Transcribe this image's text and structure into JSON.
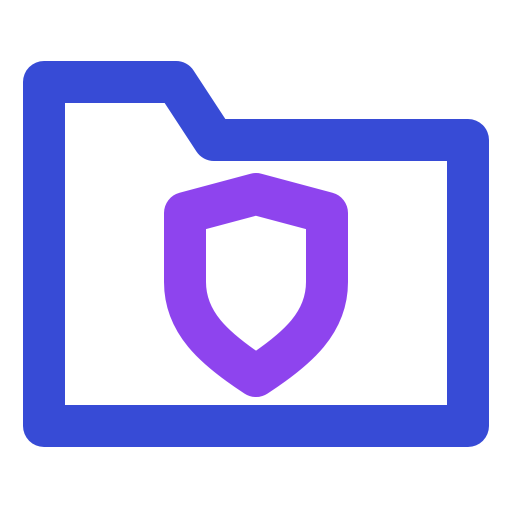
{
  "icon": {
    "name": "secure-folder-icon",
    "folder": {
      "icon": "folder-icon",
      "stroke_color": "#374BD6"
    },
    "shield": {
      "icon": "shield-icon",
      "stroke_color": "#8E44EE"
    },
    "background": "#FFFFFF"
  }
}
